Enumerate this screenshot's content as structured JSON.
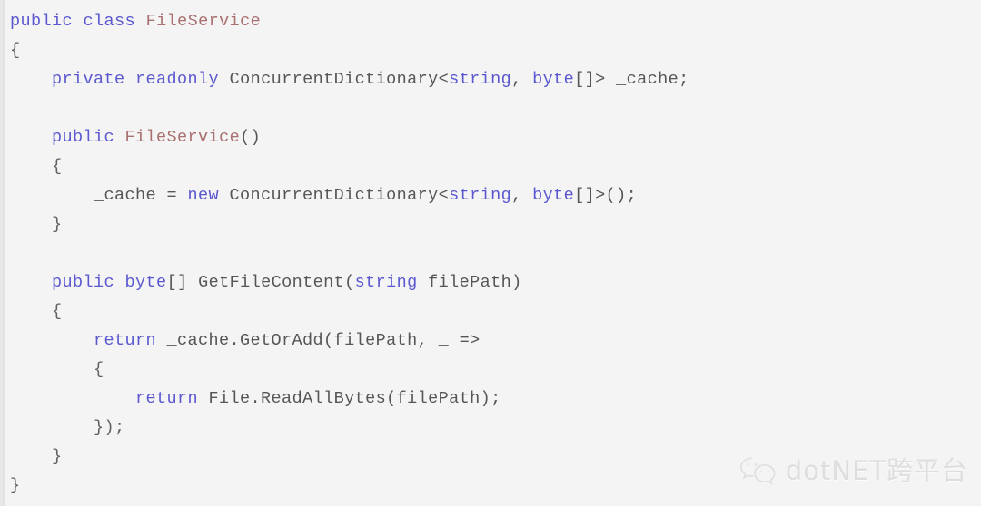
{
  "editor": {
    "language": "csharp",
    "background_color": "#f4f4f4",
    "keyword_color": "#5b58cf",
    "type_color": "#a9706f",
    "text_color": "#565656",
    "lines": [
      [
        {
          "t": "public",
          "c": "kw"
        },
        {
          "t": " ",
          "c": "plain"
        },
        {
          "t": "class",
          "c": "kw"
        },
        {
          "t": " ",
          "c": "plain"
        },
        {
          "t": "FileService",
          "c": "type"
        }
      ],
      [
        {
          "t": "{",
          "c": "punct"
        }
      ],
      [
        {
          "t": "    ",
          "c": "plain"
        },
        {
          "t": "private",
          "c": "kw"
        },
        {
          "t": " ",
          "c": "plain"
        },
        {
          "t": "readonly",
          "c": "kw"
        },
        {
          "t": " ConcurrentDictionary<",
          "c": "plain"
        },
        {
          "t": "string",
          "c": "kw"
        },
        {
          "t": ", ",
          "c": "plain"
        },
        {
          "t": "byte",
          "c": "kw"
        },
        {
          "t": "[]> _cache;",
          "c": "plain"
        }
      ],
      [
        {
          "t": "",
          "c": "plain"
        }
      ],
      [
        {
          "t": "    ",
          "c": "plain"
        },
        {
          "t": "public",
          "c": "kw"
        },
        {
          "t": " ",
          "c": "plain"
        },
        {
          "t": "FileService",
          "c": "type"
        },
        {
          "t": "()",
          "c": "plain"
        }
      ],
      [
        {
          "t": "    {",
          "c": "punct"
        }
      ],
      [
        {
          "t": "        _cache = ",
          "c": "plain"
        },
        {
          "t": "new",
          "c": "kw"
        },
        {
          "t": " ConcurrentDictionary<",
          "c": "plain"
        },
        {
          "t": "string",
          "c": "kw"
        },
        {
          "t": ", ",
          "c": "plain"
        },
        {
          "t": "byte",
          "c": "kw"
        },
        {
          "t": "[]>();",
          "c": "plain"
        }
      ],
      [
        {
          "t": "    }",
          "c": "punct"
        }
      ],
      [
        {
          "t": "",
          "c": "plain"
        }
      ],
      [
        {
          "t": "    ",
          "c": "plain"
        },
        {
          "t": "public",
          "c": "kw"
        },
        {
          "t": " ",
          "c": "plain"
        },
        {
          "t": "byte",
          "c": "kw"
        },
        {
          "t": "[] GetFileContent(",
          "c": "plain"
        },
        {
          "t": "string",
          "c": "kw"
        },
        {
          "t": " filePath)",
          "c": "plain"
        }
      ],
      [
        {
          "t": "    {",
          "c": "punct"
        }
      ],
      [
        {
          "t": "        ",
          "c": "plain"
        },
        {
          "t": "return",
          "c": "kw"
        },
        {
          "t": " _cache.GetOrAdd(filePath, _ =>",
          "c": "plain"
        }
      ],
      [
        {
          "t": "        {",
          "c": "punct"
        }
      ],
      [
        {
          "t": "            ",
          "c": "plain"
        },
        {
          "t": "return",
          "c": "kw"
        },
        {
          "t": " File.ReadAllBytes(filePath);",
          "c": "plain"
        }
      ],
      [
        {
          "t": "        });",
          "c": "punct"
        }
      ],
      [
        {
          "t": "    }",
          "c": "punct"
        }
      ],
      [
        {
          "t": "}",
          "c": "punct"
        }
      ]
    ],
    "plain_text": "public class FileService\n{\n    private readonly ConcurrentDictionary<string, byte[]> _cache;\n\n    public FileService()\n    {\n        _cache = new ConcurrentDictionary<string, byte[]>();\n    }\n\n    public byte[] GetFileContent(string filePath)\n    {\n        return _cache.GetOrAdd(filePath, _ =>\n        {\n            return File.ReadAllBytes(filePath);\n        });\n    }\n}"
  },
  "watermark": {
    "icon": "wechat-icon",
    "text": "dotNET跨平台",
    "color": "#dcdcdc"
  }
}
